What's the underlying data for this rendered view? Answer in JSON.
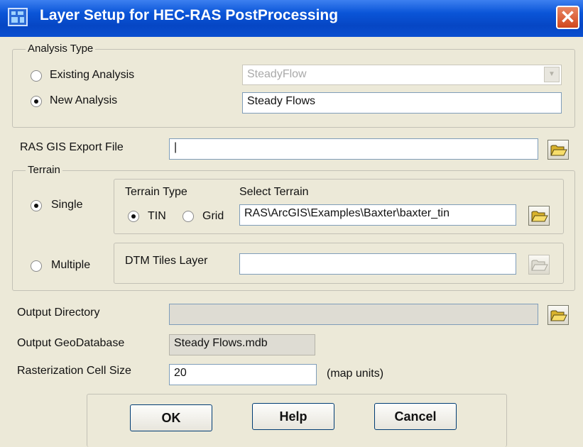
{
  "window": {
    "title": "Layer Setup for HEC-RAS PostProcessing",
    "close_label": "✕"
  },
  "analysis_type": {
    "legend": "Analysis Type",
    "existing_label": "Existing Analysis",
    "existing_value": "SteadyFlow",
    "new_label": "New Analysis",
    "new_value": "Steady Flows",
    "selected": "new"
  },
  "export_file": {
    "label": "RAS GIS Export File",
    "value": "|"
  },
  "terrain": {
    "legend": "Terrain",
    "single_label": "Single",
    "multiple_label": "Multiple",
    "selected": "single",
    "terrain_type_label": "Terrain Type",
    "select_terrain_label": "Select Terrain",
    "tin_label": "TIN",
    "grid_label": "Grid",
    "type_selected": "tin",
    "terrain_path": "RAS\\ArcGIS\\Examples\\Baxter\\baxter_tin",
    "dtm_label": "DTM Tiles Layer",
    "dtm_value": ""
  },
  "output_directory": {
    "label": "Output Directory",
    "value": ""
  },
  "output_geodatabase": {
    "label": "Output GeoDatabase",
    "value": "Steady Flows.mdb"
  },
  "rasterization": {
    "label": "Rasterization Cell Size",
    "value": "20",
    "units": "(map units)"
  },
  "buttons": {
    "ok": "OK",
    "help": "Help",
    "cancel": "Cancel"
  },
  "colors": {
    "titlebar": "#0a55d8",
    "dialog_bg": "#ece9d8",
    "close": "#d2471c"
  },
  "icons": {
    "browse": "open-folder-icon"
  }
}
